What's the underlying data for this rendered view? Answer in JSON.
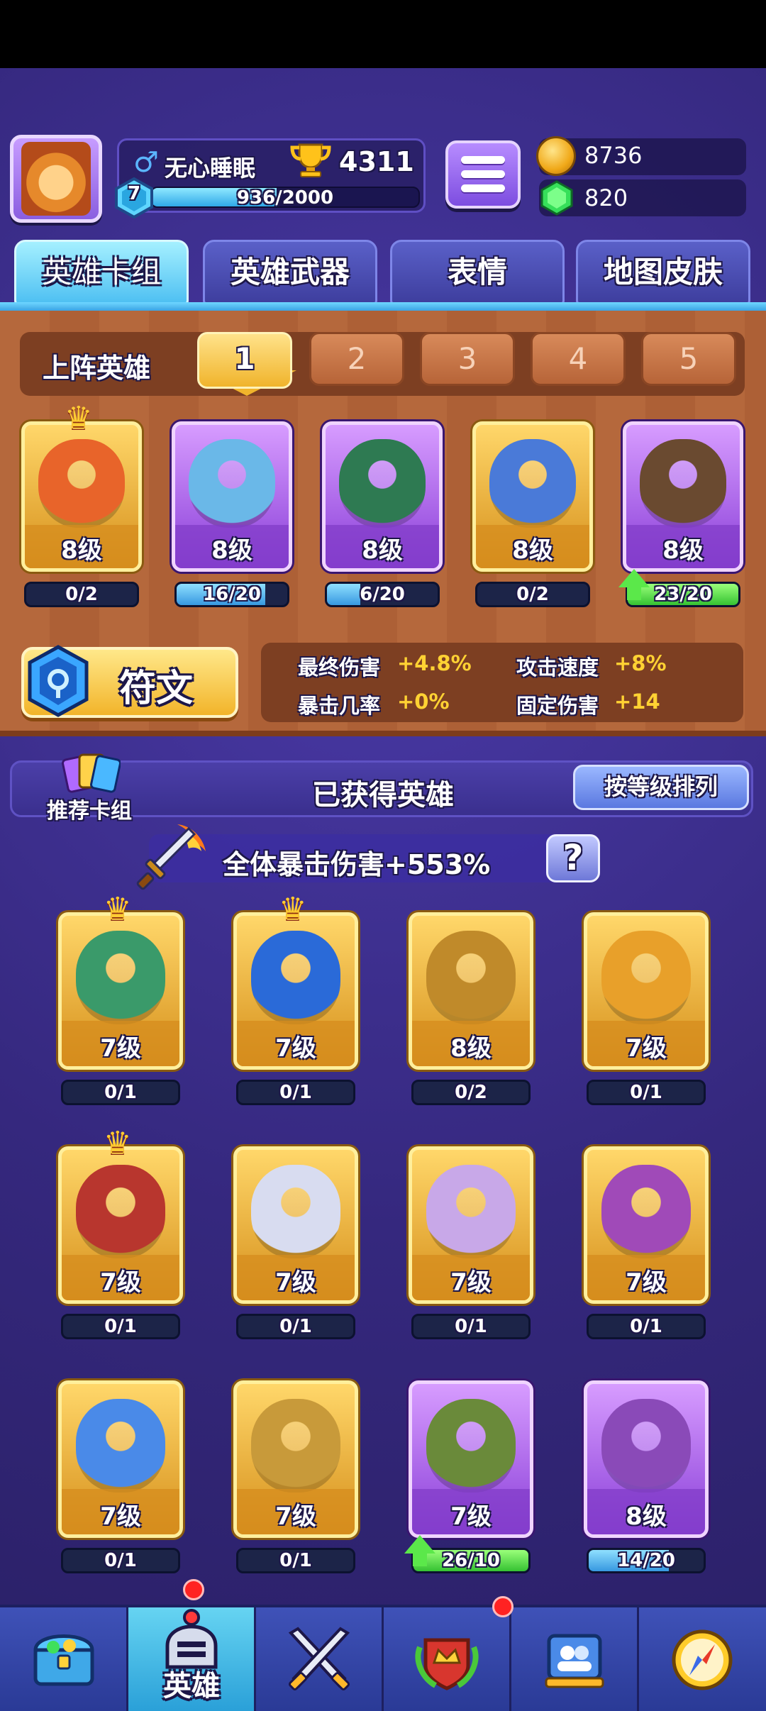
{
  "player": {
    "name": "无心睡眠",
    "gender_icon": "♂",
    "trophies": "4311",
    "level": "7",
    "xp_text": "936/2000",
    "xp_fraction": 0.468
  },
  "resources": {
    "coins": "8736",
    "gems": "820"
  },
  "tabs": [
    "英雄卡组",
    "英雄武器",
    "表情",
    "地图皮肤"
  ],
  "lineup": {
    "label": "上阵英雄",
    "slots": [
      "1",
      "2",
      "3",
      "4",
      "5"
    ],
    "active_slot": 0,
    "cards": [
      {
        "level": "8级",
        "progress": "0/2",
        "fraction": 0,
        "rarity": "gold",
        "crown": true,
        "upgrade": false
      },
      {
        "level": "8级",
        "progress": "16/20",
        "fraction": 0.8,
        "rarity": "purple",
        "crown": false,
        "upgrade": false
      },
      {
        "level": "8级",
        "progress": "6/20",
        "fraction": 0.3,
        "rarity": "purple",
        "crown": false,
        "upgrade": false
      },
      {
        "level": "8级",
        "progress": "0/2",
        "fraction": 0,
        "rarity": "gold",
        "crown": false,
        "upgrade": false
      },
      {
        "level": "8级",
        "progress": "23/20",
        "fraction": 1,
        "rarity": "purple",
        "crown": false,
        "upgrade": true
      }
    ]
  },
  "rune": {
    "label": "符文",
    "stats": [
      {
        "label": "最终伤害",
        "value": "+4.8%"
      },
      {
        "label": "攻击速度",
        "value": "+8%"
      },
      {
        "label": "暴击几率",
        "value": "+0%"
      },
      {
        "label": "固定伤害",
        "value": "+14"
      }
    ]
  },
  "collection": {
    "deck_label": "推荐卡组",
    "title": "已获得英雄",
    "sort_label": "按等级排列",
    "crit_text": "全体暴击伤害+553%",
    "help_label": "?",
    "cards": [
      {
        "level": "7级",
        "progress": "0/1",
        "fraction": 0,
        "rarity": "gold",
        "crown": true,
        "upgrade": false
      },
      {
        "level": "7级",
        "progress": "0/1",
        "fraction": 0,
        "rarity": "gold",
        "crown": true,
        "upgrade": false
      },
      {
        "level": "8级",
        "progress": "0/2",
        "fraction": 0,
        "rarity": "gold",
        "crown": false,
        "upgrade": false
      },
      {
        "level": "7级",
        "progress": "0/1",
        "fraction": 0,
        "rarity": "gold",
        "crown": false,
        "upgrade": false
      },
      {
        "level": "7级",
        "progress": "0/1",
        "fraction": 0,
        "rarity": "gold",
        "crown": true,
        "upgrade": false
      },
      {
        "level": "7级",
        "progress": "0/1",
        "fraction": 0,
        "rarity": "gold",
        "crown": false,
        "upgrade": false
      },
      {
        "level": "7级",
        "progress": "0/1",
        "fraction": 0,
        "rarity": "gold",
        "crown": false,
        "upgrade": false
      },
      {
        "level": "7级",
        "progress": "0/1",
        "fraction": 0,
        "rarity": "gold",
        "crown": false,
        "upgrade": false
      },
      {
        "level": "7级",
        "progress": "0/1",
        "fraction": 0,
        "rarity": "gold",
        "crown": false,
        "upgrade": false
      },
      {
        "level": "7级",
        "progress": "0/1",
        "fraction": 0,
        "rarity": "gold",
        "crown": false,
        "upgrade": false
      },
      {
        "level": "7级",
        "progress": "26/10",
        "fraction": 1,
        "rarity": "purple",
        "crown": false,
        "upgrade": true
      },
      {
        "level": "8级",
        "progress": "14/20",
        "fraction": 0.7,
        "rarity": "purple",
        "crown": false,
        "upgrade": false
      }
    ]
  },
  "bottom_nav": {
    "items": [
      {
        "icon": "treasure-chest-icon",
        "label": ""
      },
      {
        "icon": "knight-helmet-icon",
        "label": "英雄"
      },
      {
        "icon": "crossed-swords-icon",
        "label": ""
      },
      {
        "icon": "crown-shield-icon",
        "label": ""
      },
      {
        "icon": "team-board-icon",
        "label": ""
      },
      {
        "icon": "compass-icon",
        "label": ""
      }
    ],
    "active": 1
  },
  "colors": {
    "gold_frame": "#f0b42c",
    "purple_frame": "#8a3fd8",
    "progress_blue": "#3798e0",
    "progress_green": "#35c232",
    "stat_value": "#ffd233"
  }
}
